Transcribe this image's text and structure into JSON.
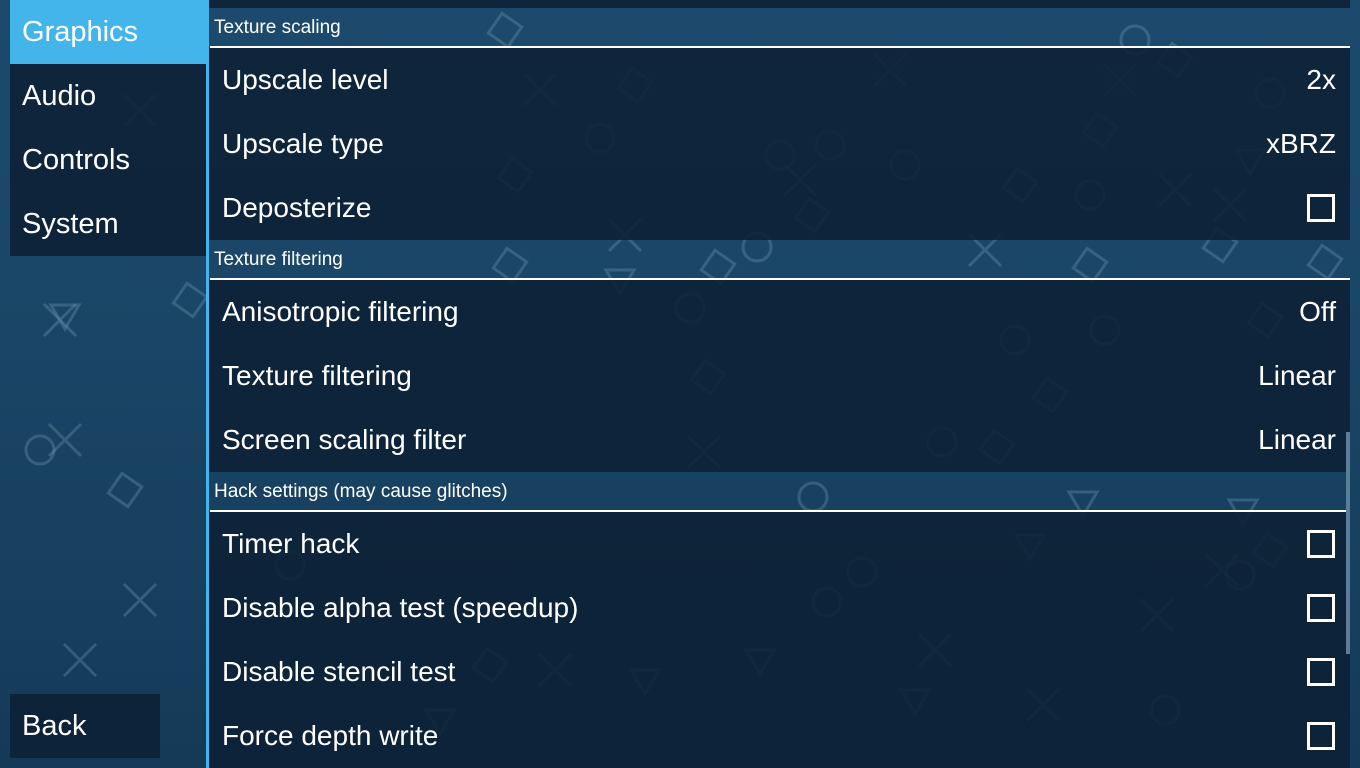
{
  "sidebar": {
    "tabs": [
      {
        "label": "Graphics",
        "active": true
      },
      {
        "label": "Audio",
        "active": false
      },
      {
        "label": "Controls",
        "active": false
      },
      {
        "label": "System",
        "active": false
      }
    ],
    "back_label": "Back"
  },
  "sections": [
    {
      "title": "Texture scaling",
      "rows": [
        {
          "label": "Upscale level",
          "value": "2x"
        },
        {
          "label": "Upscale type",
          "value": "xBRZ"
        },
        {
          "label": "Deposterize",
          "checkbox": true,
          "checked": false
        }
      ]
    },
    {
      "title": "Texture filtering",
      "rows": [
        {
          "label": "Anisotropic filtering",
          "value": "Off"
        },
        {
          "label": "Texture filtering",
          "value": "Linear"
        },
        {
          "label": "Screen scaling filter",
          "value": "Linear"
        }
      ]
    },
    {
      "title": "Hack settings (may cause glitches)",
      "rows": [
        {
          "label": "Timer hack",
          "checkbox": true,
          "checked": false
        },
        {
          "label": "Disable alpha test (speedup)",
          "checkbox": true,
          "checked": false
        },
        {
          "label": "Disable stencil test",
          "checkbox": true,
          "checked": false
        },
        {
          "label": "Force depth write",
          "checkbox": true,
          "checked": false
        }
      ]
    }
  ],
  "colors": {
    "accent": "#43b5ea",
    "panel": "#0c2034",
    "background": "#1a4566"
  }
}
